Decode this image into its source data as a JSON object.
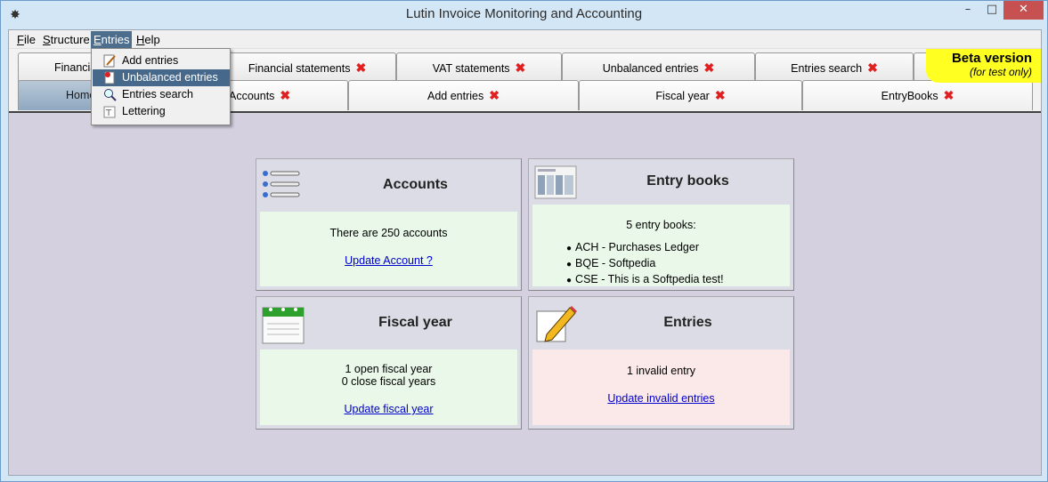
{
  "window": {
    "title": "Lutin Invoice Monitoring and Accounting",
    "minimize": "–",
    "maximize": "□",
    "close": "✕"
  },
  "menubar": {
    "file": "File",
    "structure": "Structure",
    "entries": "Entries",
    "help": "Help"
  },
  "tabs_row1": [
    {
      "label": "Financial"
    },
    {
      "label": "Financial statements"
    },
    {
      "label": "VAT statements"
    },
    {
      "label": "Unbalanced entries"
    },
    {
      "label": "Entries search"
    }
  ],
  "tabs_row2": [
    {
      "label": "Home"
    },
    {
      "label": "Accounts"
    },
    {
      "label": "Add entries"
    },
    {
      "label": "Fiscal year"
    },
    {
      "label": "EntryBooks"
    }
  ],
  "beta": {
    "line1": "Beta version",
    "line2": "(for test only)"
  },
  "entries_menu": [
    {
      "label": "Add entries",
      "icon": "pencil-icon"
    },
    {
      "label": "Unbalanced entries",
      "icon": "document-error-icon"
    },
    {
      "label": "Entries search",
      "icon": "magnifier-icon"
    },
    {
      "label": "Lettering",
      "icon": "lettering-icon"
    }
  ],
  "panels": {
    "accounts": {
      "title": "Accounts",
      "info": "There are 250 accounts",
      "link": "Update Account ?"
    },
    "entry_books": {
      "title": "Entry books",
      "info": "5 entry books:",
      "items": [
        "ACH - Purchases Ledger",
        "BQE - Softpedia",
        "CSE - This is a Softpedia test!"
      ]
    },
    "fiscal_year": {
      "title": "Fiscal year",
      "open": "1 open fiscal year",
      "closed": "0 close fiscal years",
      "link": "Update fiscal year"
    },
    "entries": {
      "title": "Entries",
      "info": "1 invalid entry",
      "link": "Update invalid entries"
    }
  },
  "colors": {
    "accent": "#46698b",
    "tab_close": "#e02020",
    "beta_bg": "#ffff22",
    "link": "#0000cc"
  }
}
